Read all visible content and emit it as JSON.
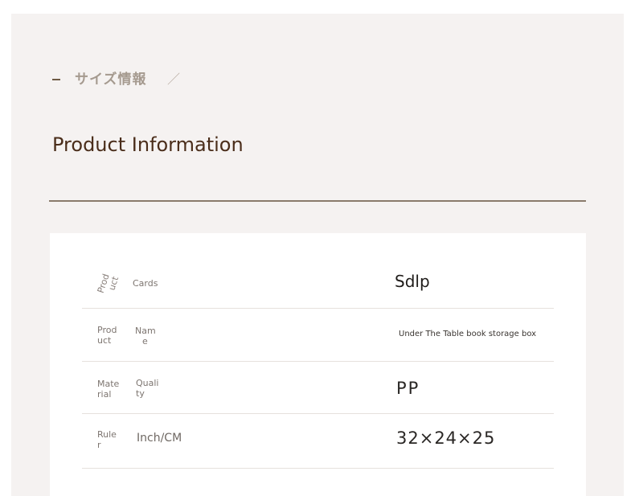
{
  "header": {
    "jp_title": "サイズ情報",
    "slash": "／",
    "title": "Product Information"
  },
  "rows": [
    {
      "label_a": [
        "Prod",
        "uct"
      ],
      "label_b": [
        "Cards"
      ],
      "value": "Sdlp"
    },
    {
      "label_a": [
        "Prod",
        "uct"
      ],
      "label_b": [
        "Nam",
        "e"
      ],
      "value": "Under The Table book storage box"
    },
    {
      "label_a": [
        "Mate",
        "rial"
      ],
      "label_b": [
        "Quali",
        "ty"
      ],
      "value": "PP"
    },
    {
      "label_a": [
        "Rule",
        "r"
      ],
      "label_b": [
        "Inch/CM"
      ],
      "value": "32×24×25"
    }
  ]
}
